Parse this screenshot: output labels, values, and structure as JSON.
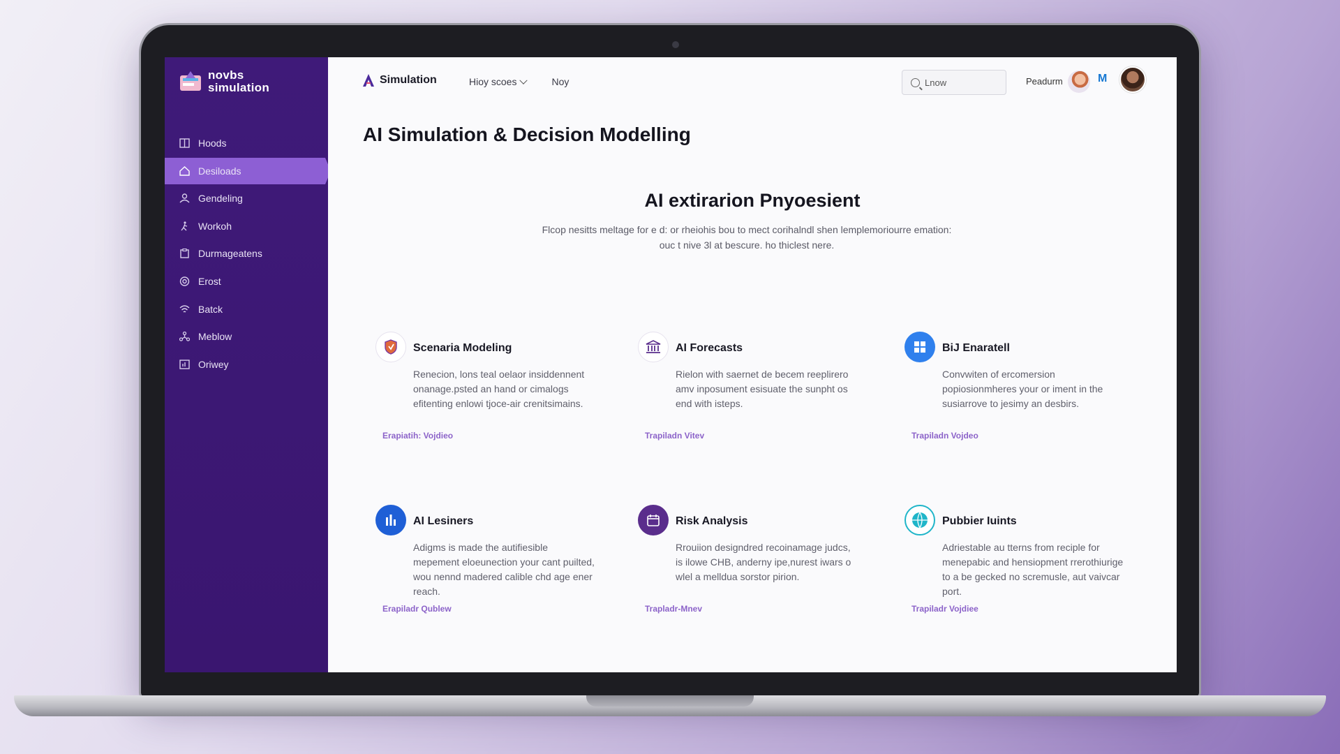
{
  "sidebar": {
    "logo_line1": "novbs",
    "logo_line2": "simulation",
    "items": [
      {
        "label": "Hoods",
        "icon": "book-icon"
      },
      {
        "label": "Desiloads",
        "icon": "home-icon"
      },
      {
        "label": "Gendeling",
        "icon": "person-icon"
      },
      {
        "label": "Workoh",
        "icon": "runner-icon"
      },
      {
        "label": "Durmageatens",
        "icon": "clipboard-icon"
      },
      {
        "label": "Erost",
        "icon": "target-icon"
      },
      {
        "label": "Batck",
        "icon": "wifi-icon"
      },
      {
        "label": "Meblow",
        "icon": "network-icon"
      },
      {
        "label": "Oriwey",
        "icon": "chart-icon"
      }
    ]
  },
  "header": {
    "brand": "Simulation",
    "menu_dropdown": "Hioy scoes",
    "menu_item": "Noy",
    "search_value": "Lnow",
    "user_label": "Peadurm"
  },
  "main": {
    "page_title": "AI Simulation & Decision Modelling",
    "hero_title": "AI extirarion Pnyoesient",
    "hero_subtitle_line1": "Flcop nesitts meltage for e d: or rheiohis bou to mect corihalndl shen lemplemoriourre emation:",
    "hero_subtitle_line2": "ouc t nive 3l at bescure. ho thiclest nere."
  },
  "cards": [
    {
      "title": "Scenaria Modeling",
      "desc": "Renecion, lons teal oelaor insiddennent onanage.psted an hand or cimalogs efitenting enlowi tjoce-air crenitsimains.",
      "link": "Erapiatih: Vojdieo",
      "icon": "shield-icon",
      "color": "#ffffff"
    },
    {
      "title": "AI Forecasts",
      "desc": "Rielon with saernet de becem reeplirero amv inposument esisuate the sunpht os end with isteps.",
      "link": "Trapiladn Vitev",
      "icon": "bank-icon",
      "color": "#ffffff"
    },
    {
      "title": "BiJ Enaratell",
      "desc": "Convwiten of ercomersion popiosionmheres your or iment in the susiarrove to jesimy an desbirs.",
      "link": "Trapiladn Vojdeo",
      "icon": "grid-icon",
      "color": "#2f80ed"
    },
    {
      "title": "AI Lesiners",
      "desc": "Adigms is made the autifiesible mepement eloeunection your cant puilted, wou nennd madered calible chd age ener reach.",
      "link": "Erapiladr Qublew",
      "icon": "bar-chart-icon",
      "color": "#1f5fd6"
    },
    {
      "title": "Risk Analysis",
      "desc": "Rrouiion designdred recoinamage judcs, is ilowe CHB, anderny ipe,nurest iwars o wlel a melldua sorstor pirion.",
      "link": "Trapladr-Mnev",
      "icon": "calendar-icon",
      "color": "#5a2d8c"
    },
    {
      "title": "Pubbier Iuints",
      "desc": "Adriestable au tterns from reciple for menepabic and hensiopment rrerothiurige to a be gecked no scremusle, aut vaivcar port.",
      "link": "Trapiladr Vojdiee",
      "icon": "globe-icon",
      "color": "#1fb5c9"
    }
  ]
}
